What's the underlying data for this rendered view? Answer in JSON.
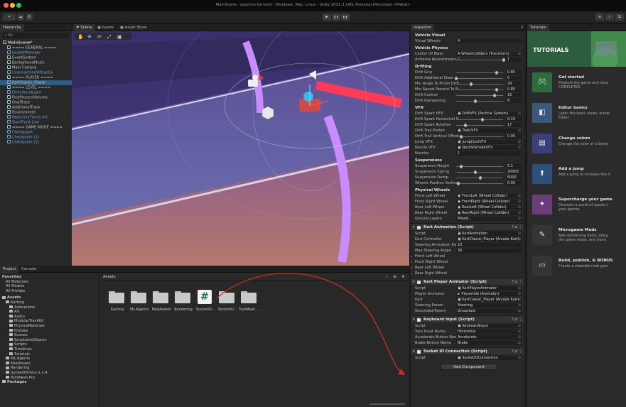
{
  "window": {
    "title": "MainScene - practice-for-tesh - Windows, Mac, Linux - Unity 2021.3.14f1 Personal (Personal) <Metal>"
  },
  "toolbar": {
    "account": "▾",
    "cloud": "☁",
    "play_icon": "▶",
    "pause_icon": "❚❚",
    "step_icon": "▶❚",
    "layers_label": "≡",
    "layout_label": "⧉"
  },
  "hierarchy": {
    "tab": "Hierarchy",
    "search": "⌕ All",
    "items": [
      {
        "label": "MainScene*",
        "depth": 0,
        "kind": "scene"
      },
      {
        "label": "==== GENERAL ====",
        "depth": 1,
        "kind": "plain"
      },
      {
        "label": "SocketManager",
        "depth": 1,
        "kind": "blue"
      },
      {
        "label": "EventSystem",
        "depth": 1,
        "kind": "plain"
      },
      {
        "label": "BackgroundMusic",
        "depth": 1,
        "kind": "plain"
      },
      {
        "label": "Main Camera",
        "depth": 1,
        "kind": "plain"
      },
      {
        "label": "CinemachineVirtualCa",
        "depth": 1,
        "kind": "blue"
      },
      {
        "label": "==== PLAYER ====",
        "depth": 1,
        "kind": "plain"
      },
      {
        "label": "KartClassic_Player",
        "depth": 1,
        "kind": "selected"
      },
      {
        "label": "==== LEVEL ====",
        "depth": 1,
        "kind": "plain"
      },
      {
        "label": "DirectionalLight",
        "depth": 1,
        "kind": "blue"
      },
      {
        "label": "PostProcessVolume",
        "depth": 1,
        "kind": "plain"
      },
      {
        "label": "OvalTrack",
        "depth": 1,
        "kind": "plain"
      },
      {
        "label": "AdditionalTrack",
        "depth": 1,
        "kind": "plain"
      },
      {
        "label": "Environment",
        "depth": 1,
        "kind": "plain"
      },
      {
        "label": "ObjectiveTimeLimit",
        "depth": 1,
        "kind": "blue"
      },
      {
        "label": "StartFinishLine",
        "depth": 1,
        "kind": "blue"
      },
      {
        "label": "==== GAME MODE ====",
        "depth": 1,
        "kind": "plain"
      },
      {
        "label": "Checkpoint",
        "depth": 1,
        "kind": "blue"
      },
      {
        "label": "Checkpoint (1)",
        "depth": 1,
        "kind": "blue"
      },
      {
        "label": "Checkpoint (2)",
        "depth": 1,
        "kind": "blue"
      }
    ]
  },
  "scene_tabs": {
    "scene": "# Scene",
    "game": "▣ Game",
    "asset_store": "▣ Asset Store"
  },
  "project": {
    "tabs": {
      "project": "Project",
      "console": "Console"
    },
    "favorites": [
      "Favorites",
      "All Materials",
      "All Models",
      "All Prefabs"
    ],
    "assets_root": "Assets",
    "tree": [
      {
        "label": "Karting",
        "depth": 1
      },
      {
        "label": "Animations",
        "depth": 2
      },
      {
        "label": "Art",
        "depth": 2
      },
      {
        "label": "Audio",
        "depth": 2
      },
      {
        "label": "ModularTrackKit",
        "depth": 2
      },
      {
        "label": "PhysicsMaterials",
        "depth": 2
      },
      {
        "label": "Prefabs",
        "depth": 2
      },
      {
        "label": "Scenes",
        "depth": 2
      },
      {
        "label": "ScriptableObjects",
        "depth": 2
      },
      {
        "label": "Scripts",
        "depth": 2
      },
      {
        "label": "Timelines",
        "depth": 2
      },
      {
        "label": "Tutorials",
        "depth": 2
      },
      {
        "label": "ML-Agents",
        "depth": 1
      },
      {
        "label": "ModAssets",
        "depth": 1
      },
      {
        "label": "Rendering",
        "depth": 1
      },
      {
        "label": "SocketIOUnity-1.1.4",
        "depth": 1
      },
      {
        "label": "TextMesh Pro",
        "depth": 1
      }
    ],
    "packages": "Packages",
    "breadcrumb": "Assets",
    "files": [
      "Karting",
      "ML-Agents",
      "ModAssets",
      "Rendering",
      "SocketIO...",
      "SocketIO...",
      "TextMesh ..."
    ],
    "script_glyph": "#"
  },
  "inspector": {
    "tab": "Inspector",
    "vehicle_visual": {
      "header": "Vehicle Visual",
      "visual_wheels_label": "Visual Wheels",
      "visual_wheels_value": "4"
    },
    "vehicle_physics": {
      "header": "Vehicle Physics",
      "com_label": "Center Of Mass",
      "com_value": "A WheelColliders (Transform)",
      "airborne_label": "Airborne Reorientation C",
      "airborne_value": "1"
    },
    "drifting": {
      "header": "Drifting",
      "rows": [
        {
          "label": "Drift Grip",
          "value": "0.85",
          "fill": 0.85
        },
        {
          "label": "Drift Additional Steer",
          "value": "0",
          "fill": 0.0
        },
        {
          "label": "Min Angle To Finish Drift",
          "value": "29",
          "fill": 0.32
        },
        {
          "label": "Min Speed Percent To Fi",
          "value": "0.85",
          "fill": 0.85
        },
        {
          "label": "Drift Control",
          "value": "16",
          "fill": 0.8
        },
        {
          "label": "Drift Dampening",
          "value": "8",
          "fill": 0.4
        }
      ]
    },
    "vfx": {
      "header": "VFX",
      "rows": [
        {
          "label": "Drift Spark VFX",
          "kind": "field",
          "value": "▣ DriftVFX (Particle System)"
        },
        {
          "label": "Drift Spark Horizontal O",
          "kind": "slider",
          "value": "0.19",
          "fill": 0.55
        },
        {
          "label": "Drift Spark Rotation",
          "kind": "slider",
          "value": "17",
          "fill": 0.2
        },
        {
          "label": "Drift Trail Prefab",
          "kind": "field",
          "value": "▣ TrailsVFX"
        },
        {
          "label": "Drift Trail Vertical Offset",
          "kind": "slider",
          "value": "0.05",
          "fill": 0.1
        },
        {
          "label": "Jump VFX",
          "kind": "field",
          "value": "▣ JumpDustVFX"
        },
        {
          "label": "Nozzle VFX",
          "kind": "field",
          "value": "▣ NozzleSmokeVFX"
        },
        {
          "label": "Nozzles",
          "kind": "number",
          "value": "1"
        }
      ]
    },
    "suspensions": {
      "header": "Suspensions",
      "rows": [
        {
          "label": "Suspension Height",
          "value": "0.1",
          "fill": 0.1
        },
        {
          "label": "Suspension Spring",
          "value": "20000",
          "fill": 0.4
        },
        {
          "label": "Suspension Damp",
          "value": "5000",
          "fill": 0.5
        },
        {
          "label": "Wheels Position Vertical",
          "value": "0.05",
          "fill": 0.05
        }
      ]
    },
    "physical_wheels": {
      "header": "Physical Wheels",
      "rows": [
        {
          "label": "Front Left Wheel",
          "value": "◉ FrontLeft (Wheel Collider)"
        },
        {
          "label": "Front Right Wheel",
          "value": "◉ FrontRight (Wheel Collider)"
        },
        {
          "label": "Rear Left Wheel",
          "value": "◉ RearLeft (Wheel Collider)"
        },
        {
          "label": "Rear Right Wheel",
          "value": "◉ RearRight (Wheel Collider)"
        },
        {
          "label": "Ground Layers",
          "value": "Mixed..."
        }
      ]
    },
    "kart_animation": {
      "header": "Kart Animation (Script)",
      "rows": [
        {
          "label": "Script",
          "value": "▣ KartAnimation"
        },
        {
          "label": "Kart Controller",
          "value": "▣ KartClassic_Player (Arcade Kart)"
        },
        {
          "label": "Steering Animation Damp",
          "value": "10"
        },
        {
          "label": "Max Steering Angle",
          "value": "30"
        },
        {
          "label": "Front Left Wheel",
          "value": ""
        },
        {
          "label": "Front Right Wheel",
          "value": ""
        },
        {
          "label": "Rear Left Wheel",
          "value": ""
        },
        {
          "label": "Rear Right Wheel",
          "value": ""
        }
      ]
    },
    "kart_player_animator": {
      "header": "Kart Player Animator (Script)",
      "rows": [
        {
          "label": "Script",
          "value": "▣ KartPlayerAnimator"
        },
        {
          "label": "Player Animator",
          "value": "► Playeridle (Animator)"
        },
        {
          "label": "Kart",
          "value": "▣ KartClassic_Player (Arcade Kart)"
        },
        {
          "label": "Steering Param",
          "value": "Steering"
        },
        {
          "label": "Grounded Param",
          "value": "Grounded"
        }
      ]
    },
    "keyboard_input": {
      "header": "Keyboard Input (Script)",
      "rows": [
        {
          "label": "Script",
          "value": "▣ KeyboardInput"
        },
        {
          "label": "Turn Input Name",
          "value": "Horizontal"
        },
        {
          "label": "Accelerate Button Name",
          "value": "Accelerate"
        },
        {
          "label": "Brake Button Name",
          "value": "Brake"
        }
      ]
    },
    "socket_io": {
      "header": "Socket IO Connection (Script)",
      "rows": [
        {
          "label": "Script",
          "value": "▣ SocketIOConnection"
        }
      ]
    },
    "add_component": "Add Component",
    "header_icons": "? ⇄ ⋮"
  },
  "tutorials": {
    "tab": "Tutorials",
    "title": "TUTORIALS",
    "cards": [
      {
        "title": "Get started",
        "desc": "Playtest the game and incre",
        "desc2": "COMPLETED",
        "color": "#2d6c3f",
        "icon": "controller-icon"
      },
      {
        "title": "Editor basics",
        "desc": "Learn the basic views, windo",
        "desc2": "Editor",
        "color": "#3b5a7a",
        "icon": "cube-icon"
      },
      {
        "title": "Change colors",
        "desc": "Change the color of a Game",
        "desc2": "",
        "color": "#3a3f7a",
        "icon": "palette-icon"
      },
      {
        "title": "Add a jump",
        "desc": "Add a jump to increase the d",
        "desc2": "",
        "color": "#2d4f7a",
        "icon": "jump-icon"
      },
      {
        "title": "Supercharge your game",
        "desc": "Discover a world of assets t",
        "desc2": "your games",
        "color": "#6a3c7a",
        "icon": "star-icon"
      },
      {
        "title": "Microgame Mods",
        "desc": "Add self-driving karts, desig",
        "desc2": "the game mode, and more",
        "color": "#353535",
        "icon": "mods-icon"
      },
      {
        "title": "Build, publish, & BONUS",
        "desc": "Create a sharable mob gam",
        "desc2": "",
        "color": "#353535",
        "icon": "build-icon"
      }
    ]
  },
  "colors": {
    "accent": "#2c5d87",
    "blue_text": "#6da6d8",
    "arrow": "#c8321e",
    "road_border": "#c98cff"
  }
}
